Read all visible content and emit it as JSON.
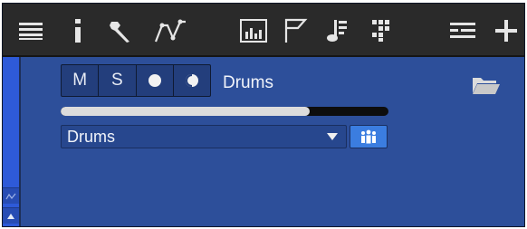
{
  "toolbar": {
    "items": [
      {
        "name": "menu-icon"
      },
      {
        "name": "info-icon"
      },
      {
        "name": "wrench-icon"
      },
      {
        "name": "automation-curve-icon"
      },
      {
        "name": "mixer-meter-icon"
      },
      {
        "name": "flag-icon"
      },
      {
        "name": "music-note-icon"
      },
      {
        "name": "pattern-grid-icon"
      },
      {
        "name": "list-layout-icon"
      },
      {
        "name": "add-icon"
      }
    ]
  },
  "track": {
    "mute_label": "M",
    "solo_label": "S",
    "record_glyph": "●",
    "monitor_glyph": "◐",
    "name": "Drums",
    "progress": 0.76,
    "instrument_value": "Drums",
    "accent_color": "#3b7de0",
    "background_color": "#2d4f9a"
  }
}
